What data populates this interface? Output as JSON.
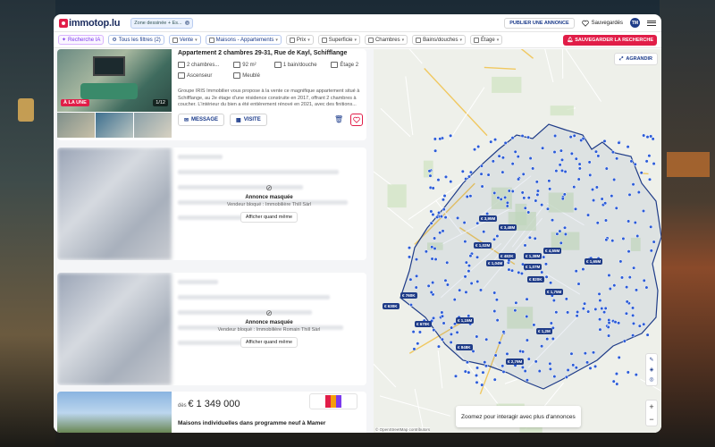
{
  "header": {
    "logo": "immotop.lu",
    "zone_chip": "Zone dessinée + Es...",
    "publish_label": "PUBLIER UNE ANNONCE",
    "saved_label": "Sauvegardés",
    "avatar_initials": "TM"
  },
  "filters": {
    "ai_label": "Recherche IA",
    "all_filters": "Tous les filtres (2)",
    "sale": "Vente",
    "types": "Maisons - Appartements",
    "price": "Prix",
    "surface": "Superficie",
    "rooms": "Chambres",
    "baths": "Bains/douches",
    "floor": "Étage",
    "save_search": "SAUVEGARDER LA RECHERCHE"
  },
  "listing1": {
    "badge": "À LA UNE",
    "photo_count": "1/12",
    "title": "Appartement 2 chambres 29-31, Rue de Kayl, Schifflange",
    "features": [
      "2 chambres...",
      "92 m²",
      "1 bain/douche",
      "Étage 2",
      "Ascenseur",
      "Meublé"
    ],
    "description": "Groupe IRIS Immobilier vous propose à la vente ce magnifique appartement situé à Schifflange, au 2e étage d'une résidence construite en 2017, offrant 2 chambres à coucher. L'intérieur du bien a été entièrement rénové en 2021, avec des finitions...",
    "message_label": "MESSAGE",
    "visit_label": "VISITE"
  },
  "masked1": {
    "title": "Annonce masquée",
    "reason": "Vendeur bloqué : Immobilière Thill Sàrl",
    "show_label": "Afficher quand même"
  },
  "masked2": {
    "title": "Annonce masquée",
    "reason": "Vendeur bloqué : Immobilière Romain Thill Sàrl",
    "show_label": "Afficher quand même"
  },
  "listing4": {
    "price_prefix": "dès",
    "price": "€ 1 349 000",
    "title": "Maisons individuelles dans programme neuf à Mamer"
  },
  "map": {
    "expand_label": "AGRANDIR",
    "zoom_hint": "Zoomez pour interagir avec plus d'annonces",
    "zoom_in": "+",
    "zoom_out": "−",
    "attribution": "© OpenStreetMap contributors",
    "price_labels": [
      "€ 3,95M",
      "€ 3,48M",
      "€ 1,02M",
      "€ 482K",
      "€ 1,04M",
      "€ 1,38M",
      "€ 4,55M",
      "€ 1,65M",
      "€ 1,07M",
      "€ 820K",
      "€ 1,75M",
      "€ 760K",
      "€ 630K",
      "€ 1,15M",
      "€ 670K",
      "€ 848K",
      "€ 1,2M",
      "€ 2,79M"
    ]
  },
  "colors": {
    "brand": "#e11d48",
    "accent": "#1a3a8a",
    "map_pin": "#1f3c88"
  }
}
